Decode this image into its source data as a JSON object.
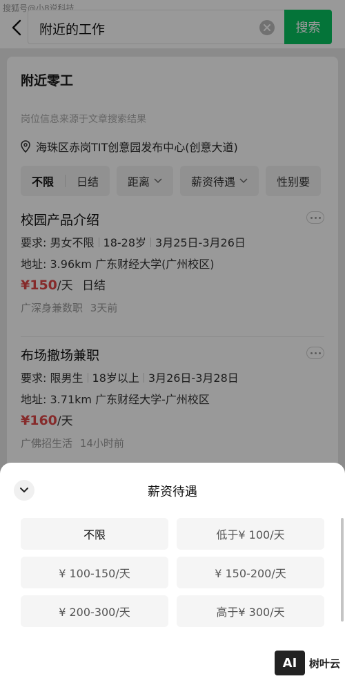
{
  "watermark": "搜狐号@小8说科技",
  "search": {
    "query": "附近的工作",
    "button_label": "搜索"
  },
  "card": {
    "title": "附近零工",
    "source_note": "岗位信息来源于文章搜索结果",
    "location": "海珠区赤岗TIT创意园发布中心(创意大道)",
    "filters": {
      "segmented": [
        "不限",
        "日结"
      ],
      "chips": [
        "距离",
        "薪资待遇",
        "性别要"
      ]
    },
    "jobs": [
      {
        "title": "校园产品介绍",
        "req_label": "要求:",
        "requirements": [
          "男女不限",
          "18-28岁",
          "3月25日-3月26日"
        ],
        "address_label": "地址:",
        "address": "3.96km 广东财经大学(广州校区)",
        "price": "¥150",
        "unit": "/天",
        "pay_type": "日结",
        "poster": "广深身兼数职",
        "time": "3天前"
      },
      {
        "title": "布场撤场兼职",
        "req_label": "要求:",
        "requirements": [
          "限男生",
          "18岁以上",
          "3月26日-3月28日"
        ],
        "address_label": "地址:",
        "address": "3.71km 广东财经大学-广州校区",
        "price": "¥160",
        "unit": "/天",
        "pay_type": "",
        "poster": "广佛招生活",
        "time": "14小时前"
      }
    ]
  },
  "sheet": {
    "title": "薪资待遇",
    "options": [
      "不限",
      "低于¥ 100/天",
      "¥ 100-150/天",
      "¥ 150-200/天",
      "¥ 200-300/天",
      "高于¥ 300/天"
    ],
    "selected": "不限"
  },
  "brand": {
    "mark": "AI",
    "name": "树叶云"
  },
  "colors": {
    "accent": "#07c160",
    "price": "#e04848"
  }
}
